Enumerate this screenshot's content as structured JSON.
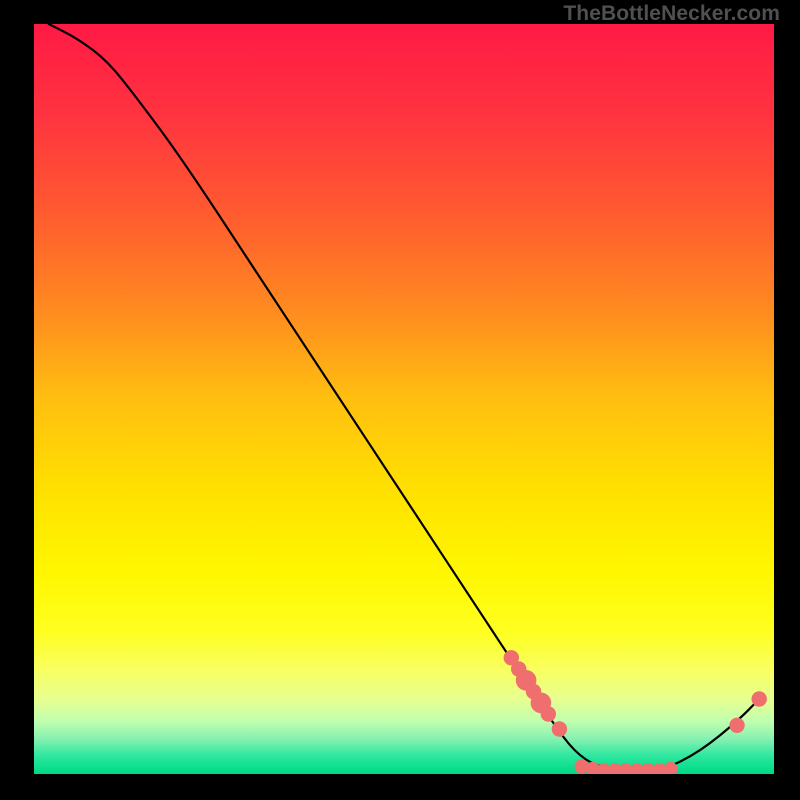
{
  "watermark": "TheBottleNecker.com",
  "chart_data": {
    "type": "line",
    "title": "",
    "xlabel": "",
    "ylabel": "",
    "xlim": [
      0,
      100
    ],
    "ylim": [
      0,
      100
    ],
    "curve": {
      "points": [
        {
          "x": 2,
          "y": 100
        },
        {
          "x": 6,
          "y": 98
        },
        {
          "x": 10,
          "y": 95
        },
        {
          "x": 14,
          "y": 90
        },
        {
          "x": 20,
          "y": 82
        },
        {
          "x": 30,
          "y": 67
        },
        {
          "x": 40,
          "y": 52
        },
        {
          "x": 50,
          "y": 37
        },
        {
          "x": 60,
          "y": 22
        },
        {
          "x": 66,
          "y": 13
        },
        {
          "x": 70,
          "y": 7
        },
        {
          "x": 73,
          "y": 3
        },
        {
          "x": 76,
          "y": 1
        },
        {
          "x": 80,
          "y": 0.5
        },
        {
          "x": 85,
          "y": 0.5
        },
        {
          "x": 90,
          "y": 3
        },
        {
          "x": 95,
          "y": 7
        },
        {
          "x": 98,
          "y": 10
        }
      ]
    },
    "markers": [
      {
        "x": 64.5,
        "y": 15.5,
        "r": 0.9
      },
      {
        "x": 65.5,
        "y": 14.0,
        "r": 0.9
      },
      {
        "x": 66.5,
        "y": 12.5,
        "r": 1.4
      },
      {
        "x": 67.5,
        "y": 11.0,
        "r": 0.9
      },
      {
        "x": 68.5,
        "y": 9.5,
        "r": 1.4
      },
      {
        "x": 69.5,
        "y": 8.0,
        "r": 0.9
      },
      {
        "x": 71.0,
        "y": 6.0,
        "r": 0.9
      },
      {
        "x": 74.0,
        "y": 1.0,
        "r": 0.8
      },
      {
        "x": 75.5,
        "y": 0.7,
        "r": 0.8
      },
      {
        "x": 77.0,
        "y": 0.5,
        "r": 0.8
      },
      {
        "x": 78.5,
        "y": 0.5,
        "r": 0.8
      },
      {
        "x": 80.0,
        "y": 0.5,
        "r": 0.8
      },
      {
        "x": 81.5,
        "y": 0.5,
        "r": 0.8
      },
      {
        "x": 83.0,
        "y": 0.5,
        "r": 0.8
      },
      {
        "x": 84.5,
        "y": 0.5,
        "r": 0.8
      },
      {
        "x": 86.0,
        "y": 0.7,
        "r": 0.8
      },
      {
        "x": 95.0,
        "y": 6.5,
        "r": 0.9
      },
      {
        "x": 98.0,
        "y": 10.0,
        "r": 0.9
      }
    ],
    "gradient_bands": [
      {
        "offset": 0.0,
        "color": "#ff1a44"
      },
      {
        "offset": 0.12,
        "color": "#ff3340"
      },
      {
        "offset": 0.25,
        "color": "#ff5a30"
      },
      {
        "offset": 0.38,
        "color": "#ff8a20"
      },
      {
        "offset": 0.5,
        "color": "#ffbf10"
      },
      {
        "offset": 0.62,
        "color": "#ffe000"
      },
      {
        "offset": 0.73,
        "color": "#fff700"
      },
      {
        "offset": 0.81,
        "color": "#ffff20"
      },
      {
        "offset": 0.86,
        "color": "#f8ff60"
      },
      {
        "offset": 0.9,
        "color": "#e8ff90"
      },
      {
        "offset": 0.93,
        "color": "#c0ffb0"
      },
      {
        "offset": 0.955,
        "color": "#80f0b0"
      },
      {
        "offset": 0.975,
        "color": "#30e8a0"
      },
      {
        "offset": 0.99,
        "color": "#10df90"
      },
      {
        "offset": 1.0,
        "color": "#00d880"
      }
    ]
  }
}
